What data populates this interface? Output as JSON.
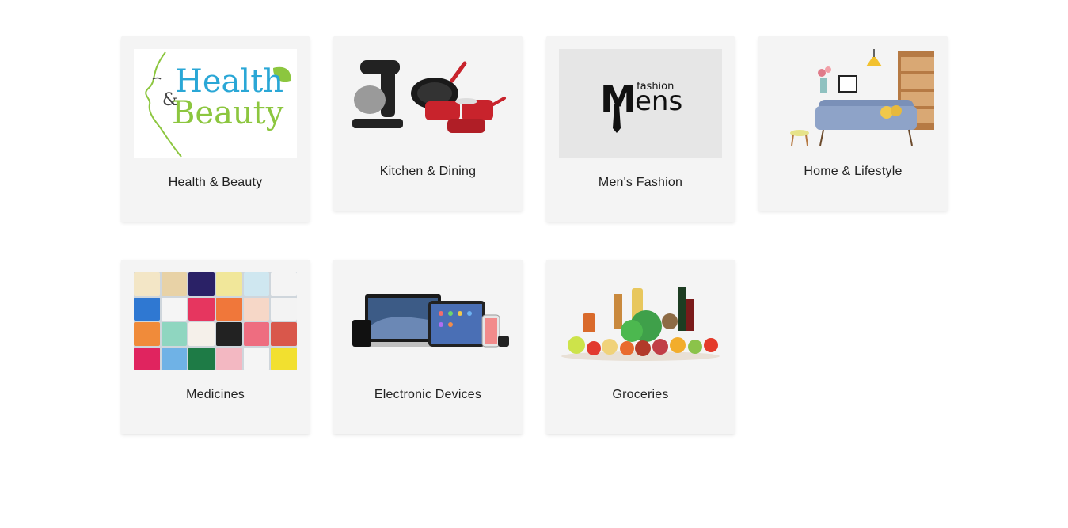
{
  "categories": [
    {
      "label": "Health & Beauty",
      "icon": "health-beauty-image"
    },
    {
      "label": "Kitchen & Dining",
      "icon": "kitchen-dining-image"
    },
    {
      "label": "Men's Fashion",
      "icon": "mens-fashion-image"
    },
    {
      "label": "Home & Lifestyle",
      "icon": "home-lifestyle-image"
    },
    {
      "label": "Medicines",
      "icon": "medicines-image"
    },
    {
      "label": "Electronic Devices",
      "icon": "electronic-devices-image"
    },
    {
      "label": "Groceries",
      "icon": "groceries-image"
    }
  ],
  "thumbs": {
    "health_beauty": {
      "line1": "Health",
      "amp": "&",
      "line2": "Beauty"
    },
    "mens_fashion": {
      "m": "M",
      "ens": "ens",
      "fashion": "fashion"
    }
  },
  "colors": {
    "card_bg": "#f4f4f4",
    "health_blue": "#2aa7d6",
    "beauty_green": "#8cc63f",
    "kitchen_red": "#c8232c"
  }
}
